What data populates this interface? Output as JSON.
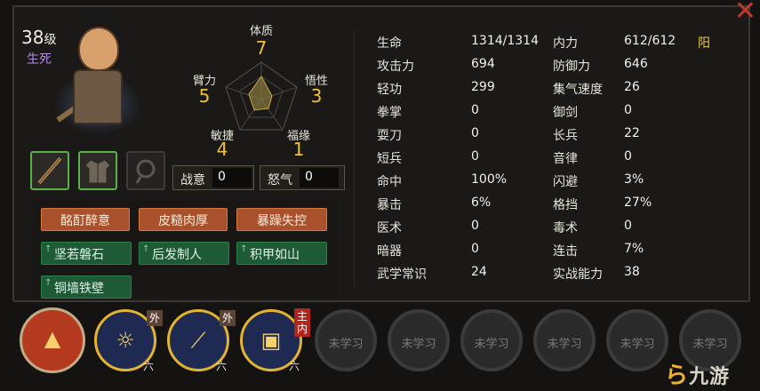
{
  "character": {
    "level": "38",
    "level_unit": "级",
    "status_tag": "生死"
  },
  "radar": {
    "constitution": {
      "label": "体质",
      "value": "7"
    },
    "arm_strength": {
      "label": "臂力",
      "value": "5"
    },
    "perception": {
      "label": "悟性",
      "value": "3"
    },
    "agility": {
      "label": "敏捷",
      "value": "4"
    },
    "fortune": {
      "label": "福缘",
      "value": "1"
    }
  },
  "equipment": {
    "slots": [
      {
        "icon": "staff-icon",
        "state": "equipped"
      },
      {
        "icon": "robe-icon",
        "state": "equipped"
      },
      {
        "icon": "accessory-icon",
        "state": "empty"
      }
    ]
  },
  "meters": {
    "fighting_spirit": {
      "label": "战意",
      "value": "0"
    },
    "rage": {
      "label": "怒气",
      "value": "0"
    }
  },
  "traits": {
    "orange": [
      "酩酊醉意",
      "皮糙肉厚",
      "暴躁失控"
    ],
    "green": [
      "坚若磐石",
      "后发制人",
      "积甲如山",
      "铜墙铁壁"
    ]
  },
  "stats": {
    "left": [
      {
        "label": "生命",
        "value": "1314/1314"
      },
      {
        "label": "攻击力",
        "value": "694"
      },
      {
        "label": "轻功",
        "value": "299"
      },
      {
        "label": "拳掌",
        "value": "0"
      },
      {
        "label": "耍刀",
        "value": "0"
      },
      {
        "label": "短兵",
        "value": "0"
      },
      {
        "label": "命中",
        "value": "100%"
      },
      {
        "label": "暴击",
        "value": "6%"
      },
      {
        "label": "医术",
        "value": "0"
      },
      {
        "label": "暗器",
        "value": "0"
      },
      {
        "label": "武学常识",
        "value": "24"
      }
    ],
    "right": [
      {
        "label": "内力",
        "value": "612/612"
      },
      {
        "label": "防御力",
        "value": "646"
      },
      {
        "label": "集气速度",
        "value": "26"
      },
      {
        "label": "御剑",
        "value": "0"
      },
      {
        "label": "长兵",
        "value": "22"
      },
      {
        "label": "音律",
        "value": "0"
      },
      {
        "label": "闪避",
        "value": "3%"
      },
      {
        "label": "格挡",
        "value": "27%"
      },
      {
        "label": "毒术",
        "value": "0"
      },
      {
        "label": "连击",
        "value": "7%"
      },
      {
        "label": "实战能力",
        "value": "38"
      }
    ],
    "alignment": "阳"
  },
  "skills": {
    "learned": [
      {
        "icon": "flame-skill-icon",
        "badge": "",
        "tier": ""
      },
      {
        "icon": "staff-skill-icon",
        "badge": "外",
        "tier": "六"
      },
      {
        "icon": "staff-strike-icon",
        "badge": "外",
        "tier": "六"
      },
      {
        "icon": "armor-skill-icon",
        "badge": "主内",
        "tier": "六"
      }
    ],
    "locked_label": "未学习"
  },
  "watermark": {
    "symbol": "ら",
    "text": "九游"
  }
}
